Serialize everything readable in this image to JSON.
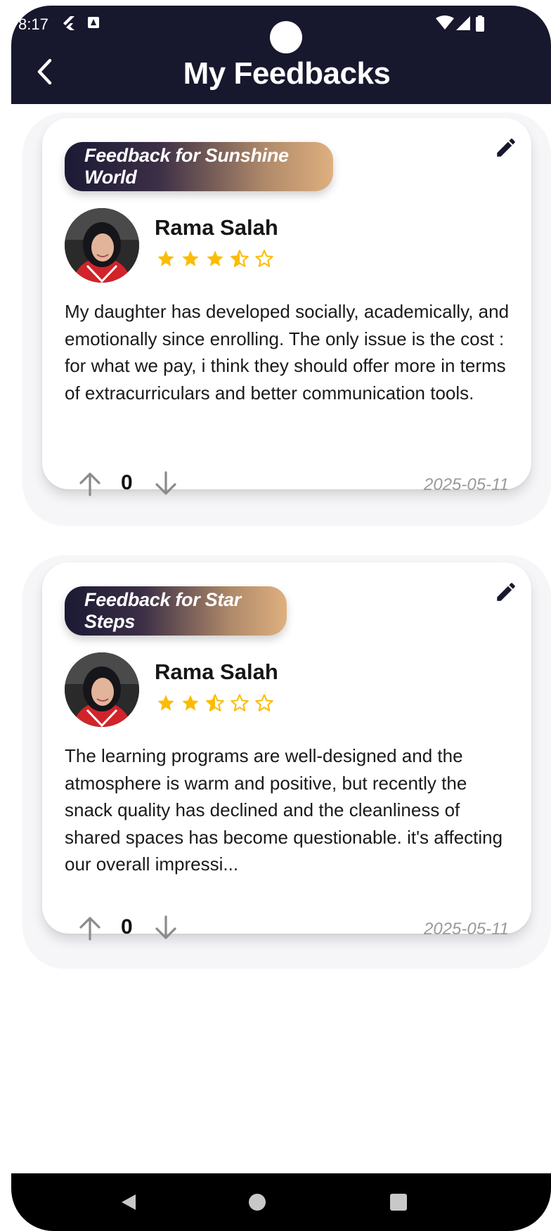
{
  "status_bar": {
    "time": "8:17"
  },
  "header": {
    "title": "My Feedbacks"
  },
  "feedbacks": [
    {
      "tag": "Feedback for Sunshine World",
      "author": "Rama Salah",
      "rating": 3.5,
      "text": "My daughter has developed socially, academically, and emotionally since enrolling. The only issue is the cost : for what we pay, i think they should offer more in terms of extracurriculars and better communication tools.",
      "votes": "0",
      "date": "2025-05-11"
    },
    {
      "tag": "Feedback for Star Steps",
      "author": "Rama Salah",
      "rating": 2.5,
      "text": "The learning programs are well-designed and the atmosphere is warm and positive, but recently the snack quality has declined and the cleanliness of shared spaces has become questionable. it's affecting our overall impressi...",
      "votes": "0",
      "date": "2025-05-11"
    }
  ],
  "colors": {
    "header_bg": "#17172e",
    "star": "#fbbc05",
    "tag_gradient_start": "#1b1934",
    "tag_gradient_end": "#dfb07f"
  },
  "icons": [
    "back-arrow-icon",
    "edit-pencil-icon",
    "star-icon",
    "arrow-up-icon",
    "arrow-down-icon",
    "nav-back-icon",
    "nav-home-icon",
    "nav-recents-icon"
  ]
}
